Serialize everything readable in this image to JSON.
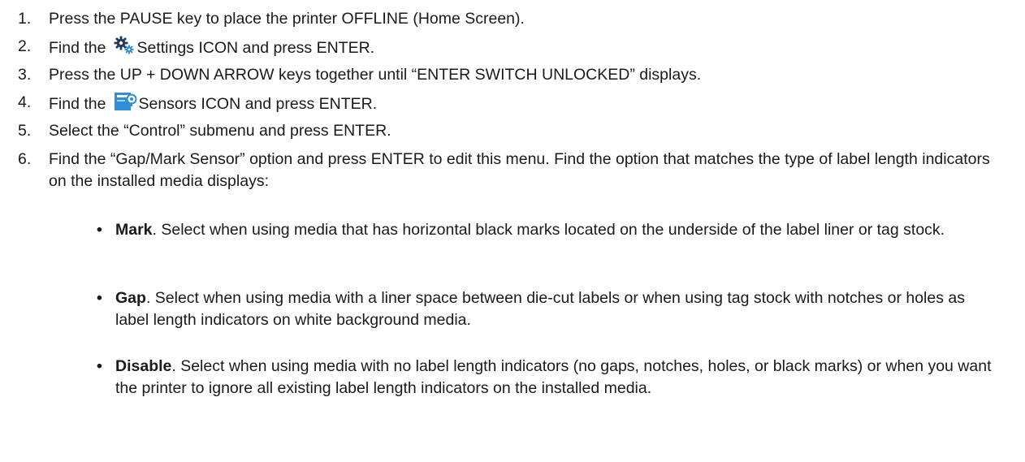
{
  "steps": [
    {
      "num": "1.",
      "text": "Press the PAUSE key to place the printer OFFLINE (Home Screen)."
    },
    {
      "num": "2.",
      "pre": "Find the",
      "icon": "gear-icon",
      "post": "Settings ICON and press ENTER."
    },
    {
      "num": "3.",
      "text": "Press the UP + DOWN ARROW keys together until “ENTER SWITCH UNLOCKED” displays."
    },
    {
      "num": "4.",
      "pre": "Find the",
      "icon": "sensors-icon",
      "post": "Sensors ICON and press ENTER."
    },
    {
      "num": "5.",
      "text": "Select the “Control” submenu and press ENTER."
    },
    {
      "num": "6.",
      "text": "Find the “Gap/Mark Sensor” option and press ENTER to edit this menu. Find the option that matches the type of label length indicators on the installed media displays:"
    }
  ],
  "options": [
    {
      "term": "Mark",
      "desc": ". Select when using media that has horizontal black marks located on the underside of the label liner or tag stock."
    },
    {
      "term": "Gap",
      "desc": ". Select when using media with a liner space between die-cut labels or when using tag stock with notches or holes as label length indicators on white background media."
    },
    {
      "term": "Disable",
      "desc": ". Select when using media with no label length indicators (no gaps, notches, holes, or black marks) or when you want the printer to ignore all existing label length indicators on the installed media."
    }
  ],
  "bullet_glyph": "•",
  "colors": {
    "text": "#1a1a1a",
    "icon_blue": "#2e8fd6",
    "gear_dark": "#1f3a5a"
  }
}
